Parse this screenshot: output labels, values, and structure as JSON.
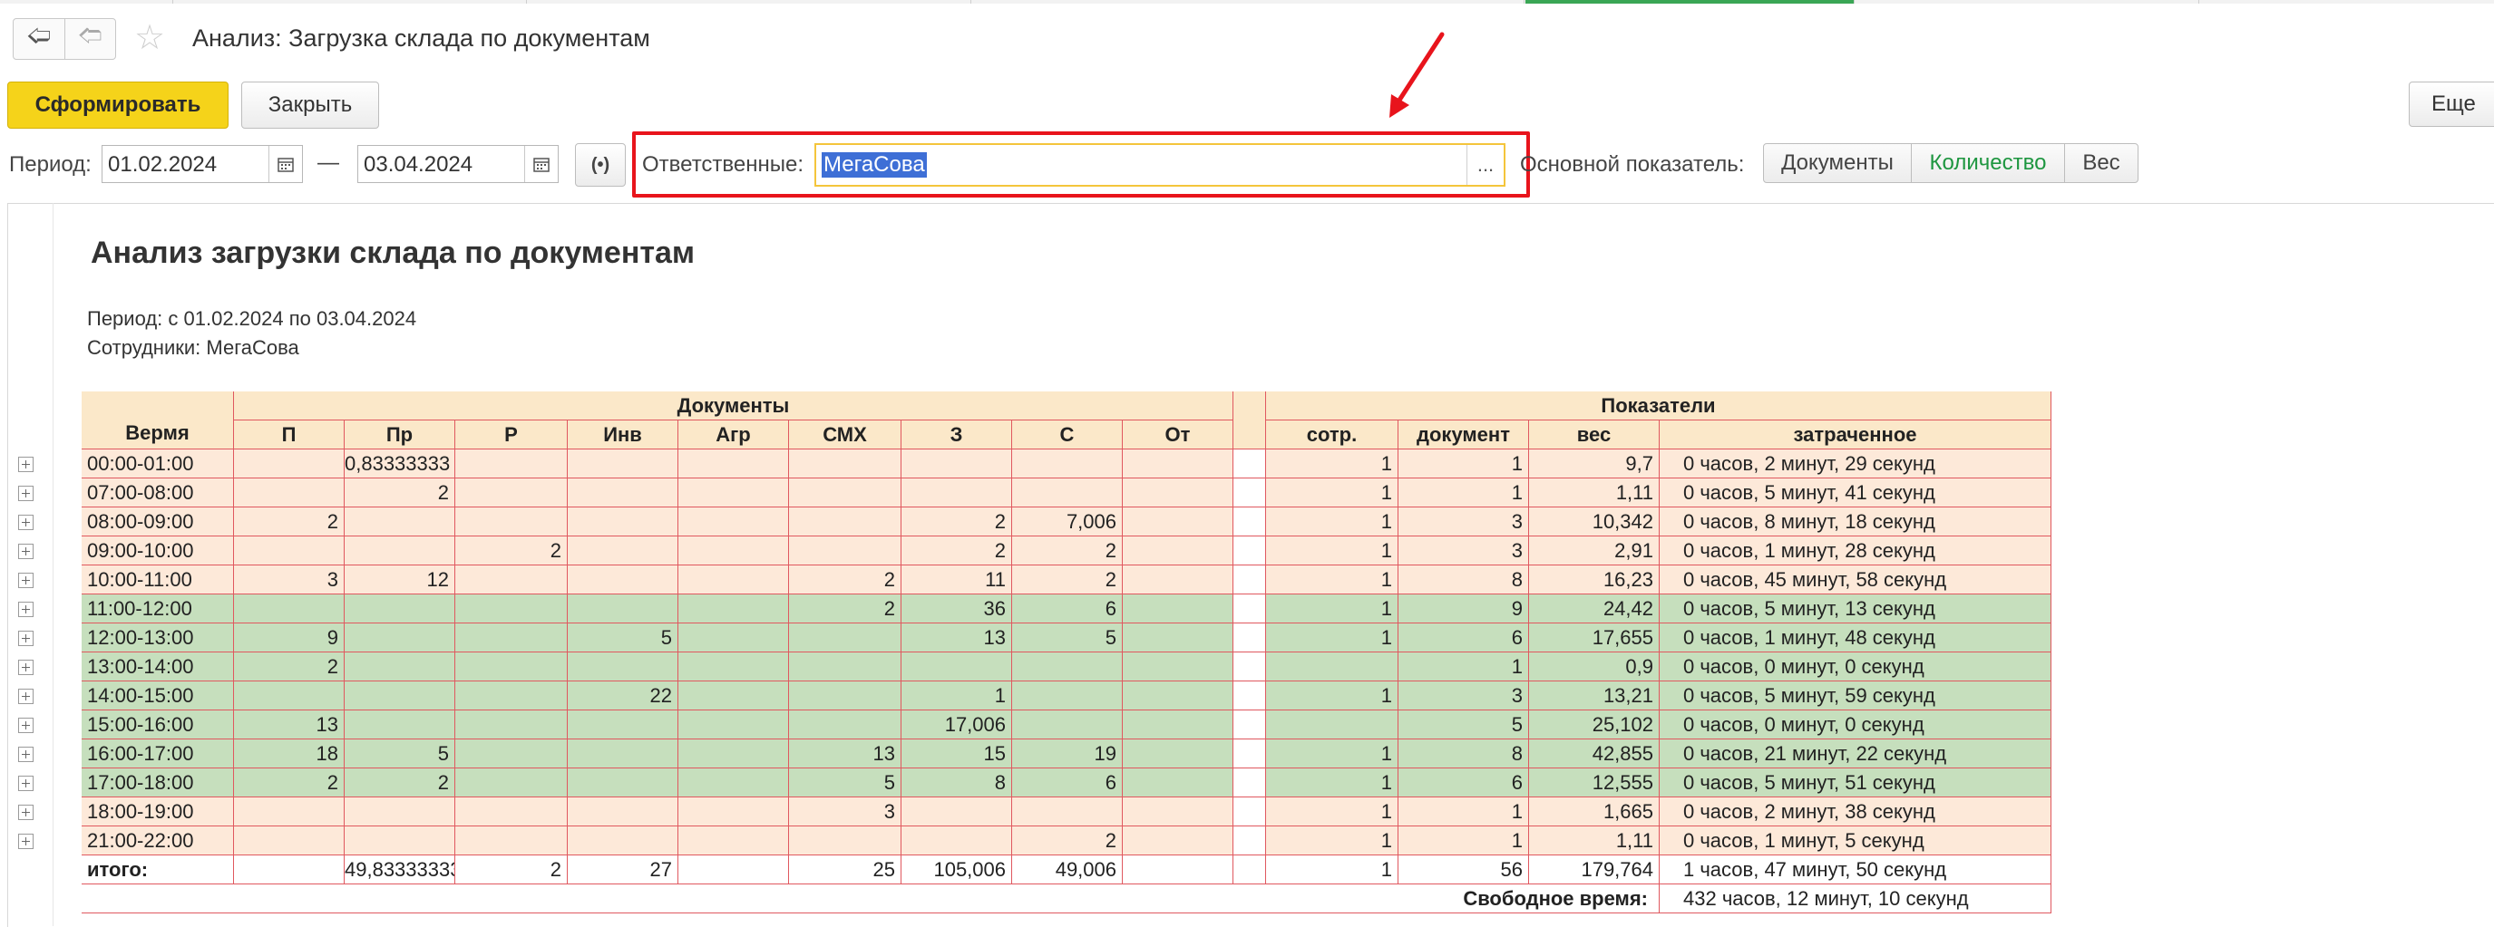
{
  "window": {
    "title": "Анализ: Загрузка склада по документам"
  },
  "toolbar": {
    "generate_label": "Сформировать",
    "close_label": "Закрыть",
    "more_label": "Еще"
  },
  "params": {
    "period_label": "Период:",
    "date_from": "01.02.2024",
    "dash": "—",
    "date_to": "03.04.2024",
    "responsible_label": "Ответственные:",
    "responsible_value": "МегаСова",
    "select_button": "...",
    "indicator_label": "Основной показатель:",
    "indicator_options": [
      "Документы",
      "Количество",
      "Вес"
    ],
    "indicator_selected": "Количество"
  },
  "report": {
    "title": "Анализ загрузки склада по документам",
    "period_line": "Период: с 01.02.2024 по 03.04.2024",
    "employees_line": "Сотрудники: МегаСова",
    "group_docs": "Документы",
    "group_indicators": "Показатели",
    "col_time": "Вермя",
    "doc_columns": [
      "П",
      "Пр",
      "Р",
      "Инв",
      "Агр",
      "СМХ",
      "З",
      "С",
      "От"
    ],
    "ind_columns": [
      "сотр.",
      "документ",
      "вес",
      "затраченное"
    ],
    "rows": [
      {
        "time": "00:00-01:00",
        "docs": [
          "",
          "0,83333333",
          "",
          "",
          "",
          "",
          "",
          "",
          ""
        ],
        "sotr": "1",
        "doc": "1",
        "ves": "9,7",
        "spent": "0 часов, 2 минут, 29 секунд",
        "color": "peach"
      },
      {
        "time": "07:00-08:00",
        "docs": [
          "",
          "2",
          "",
          "",
          "",
          "",
          "",
          "",
          ""
        ],
        "sotr": "1",
        "doc": "1",
        "ves": "1,11",
        "spent": "0 часов, 5 минут, 41 секунд",
        "color": "peach"
      },
      {
        "time": "08:00-09:00",
        "docs": [
          "2",
          "",
          "",
          "",
          "",
          "",
          "2",
          "7,006",
          ""
        ],
        "sotr": "1",
        "doc": "3",
        "ves": "10,342",
        "spent": "0 часов, 8 минут, 18 секунд",
        "color": "peach"
      },
      {
        "time": "09:00-10:00",
        "docs": [
          "",
          "",
          "2",
          "",
          "",
          "",
          "2",
          "2",
          ""
        ],
        "sotr": "1",
        "doc": "3",
        "ves": "2,91",
        "spent": "0 часов, 1 минут, 28 секунд",
        "color": "peach"
      },
      {
        "time": "10:00-11:00",
        "docs": [
          "3",
          "12",
          "",
          "",
          "",
          "2",
          "11",
          "2",
          ""
        ],
        "sotr": "1",
        "doc": "8",
        "ves": "16,23",
        "spent": "0 часов, 45 минут, 58 секунд",
        "color": "peach"
      },
      {
        "time": "11:00-12:00",
        "docs": [
          "",
          "",
          "",
          "",
          "",
          "2",
          "36",
          "6",
          ""
        ],
        "sotr": "1",
        "doc": "9",
        "ves": "24,42",
        "spent": "0 часов, 5 минут, 13 секунд",
        "color": "green"
      },
      {
        "time": "12:00-13:00",
        "docs": [
          "9",
          "",
          "",
          "5",
          "",
          "",
          "13",
          "5",
          ""
        ],
        "sotr": "1",
        "doc": "6",
        "ves": "17,655",
        "spent": "0 часов, 1 минут, 48 секунд",
        "color": "green"
      },
      {
        "time": "13:00-14:00",
        "docs": [
          "2",
          "",
          "",
          "",
          "",
          "",
          "",
          "",
          ""
        ],
        "sotr": "",
        "doc": "1",
        "ves": "0,9",
        "spent": "0 часов, 0 минут, 0 секунд",
        "color": "green"
      },
      {
        "time": "14:00-15:00",
        "docs": [
          "",
          "",
          "",
          "22",
          "",
          "",
          "1",
          "",
          ""
        ],
        "sotr": "1",
        "doc": "3",
        "ves": "13,21",
        "spent": "0 часов, 5 минут, 59 секунд",
        "color": "green"
      },
      {
        "time": "15:00-16:00",
        "docs": [
          "13",
          "",
          "",
          "",
          "",
          "",
          "17,006",
          "",
          ""
        ],
        "sotr": "",
        "doc": "5",
        "ves": "25,102",
        "spent": "0 часов, 0 минут, 0 секунд",
        "color": "green"
      },
      {
        "time": "16:00-17:00",
        "docs": [
          "18",
          "5",
          "",
          "",
          "",
          "13",
          "15",
          "19",
          ""
        ],
        "sotr": "1",
        "doc": "8",
        "ves": "42,855",
        "spent": "0 часов, 21 минут, 22 секунд",
        "color": "green"
      },
      {
        "time": "17:00-18:00",
        "docs": [
          "2",
          "2",
          "",
          "",
          "",
          "5",
          "8",
          "6",
          ""
        ],
        "sotr": "1",
        "doc": "6",
        "ves": "12,555",
        "spent": "0 часов, 5 минут, 51 секунд",
        "color": "green"
      },
      {
        "time": "18:00-19:00",
        "docs": [
          "",
          "",
          "",
          "",
          "",
          "3",
          "",
          "",
          ""
        ],
        "sotr": "1",
        "doc": "1",
        "ves": "1,665",
        "spent": "0 часов, 2 минут, 38 секунд",
        "color": "peach"
      },
      {
        "time": "21:00-22:00",
        "docs": [
          "",
          "",
          "",
          "",
          "",
          "",
          "",
          "2",
          ""
        ],
        "sotr": "1",
        "doc": "1",
        "ves": "1,11",
        "spent": "0 часов, 1 минут, 5 секунд",
        "color": "peach"
      }
    ],
    "total": {
      "time": "итого:",
      "docs": [
        "",
        "49,83333333",
        "2",
        "27",
        "",
        "25",
        "105,006",
        "49,006",
        ""
      ],
      "sotr": "1",
      "doc": "56",
      "ves": "179,764",
      "spent": "1 часов, 47 минут, 50 секунд"
    },
    "free_time_label": "Свободное время:",
    "free_time_value": "432 часов, 12 минут, 10 секунд"
  },
  "colors": {
    "peach": "#fde9d9",
    "green": "#c6dfbd",
    "header": "#fbe8c9",
    "grid": "#e0585f",
    "highlight_red": "#e8141c",
    "accent_green": "#1e9640",
    "generate_yellow": "#f5d31a"
  }
}
